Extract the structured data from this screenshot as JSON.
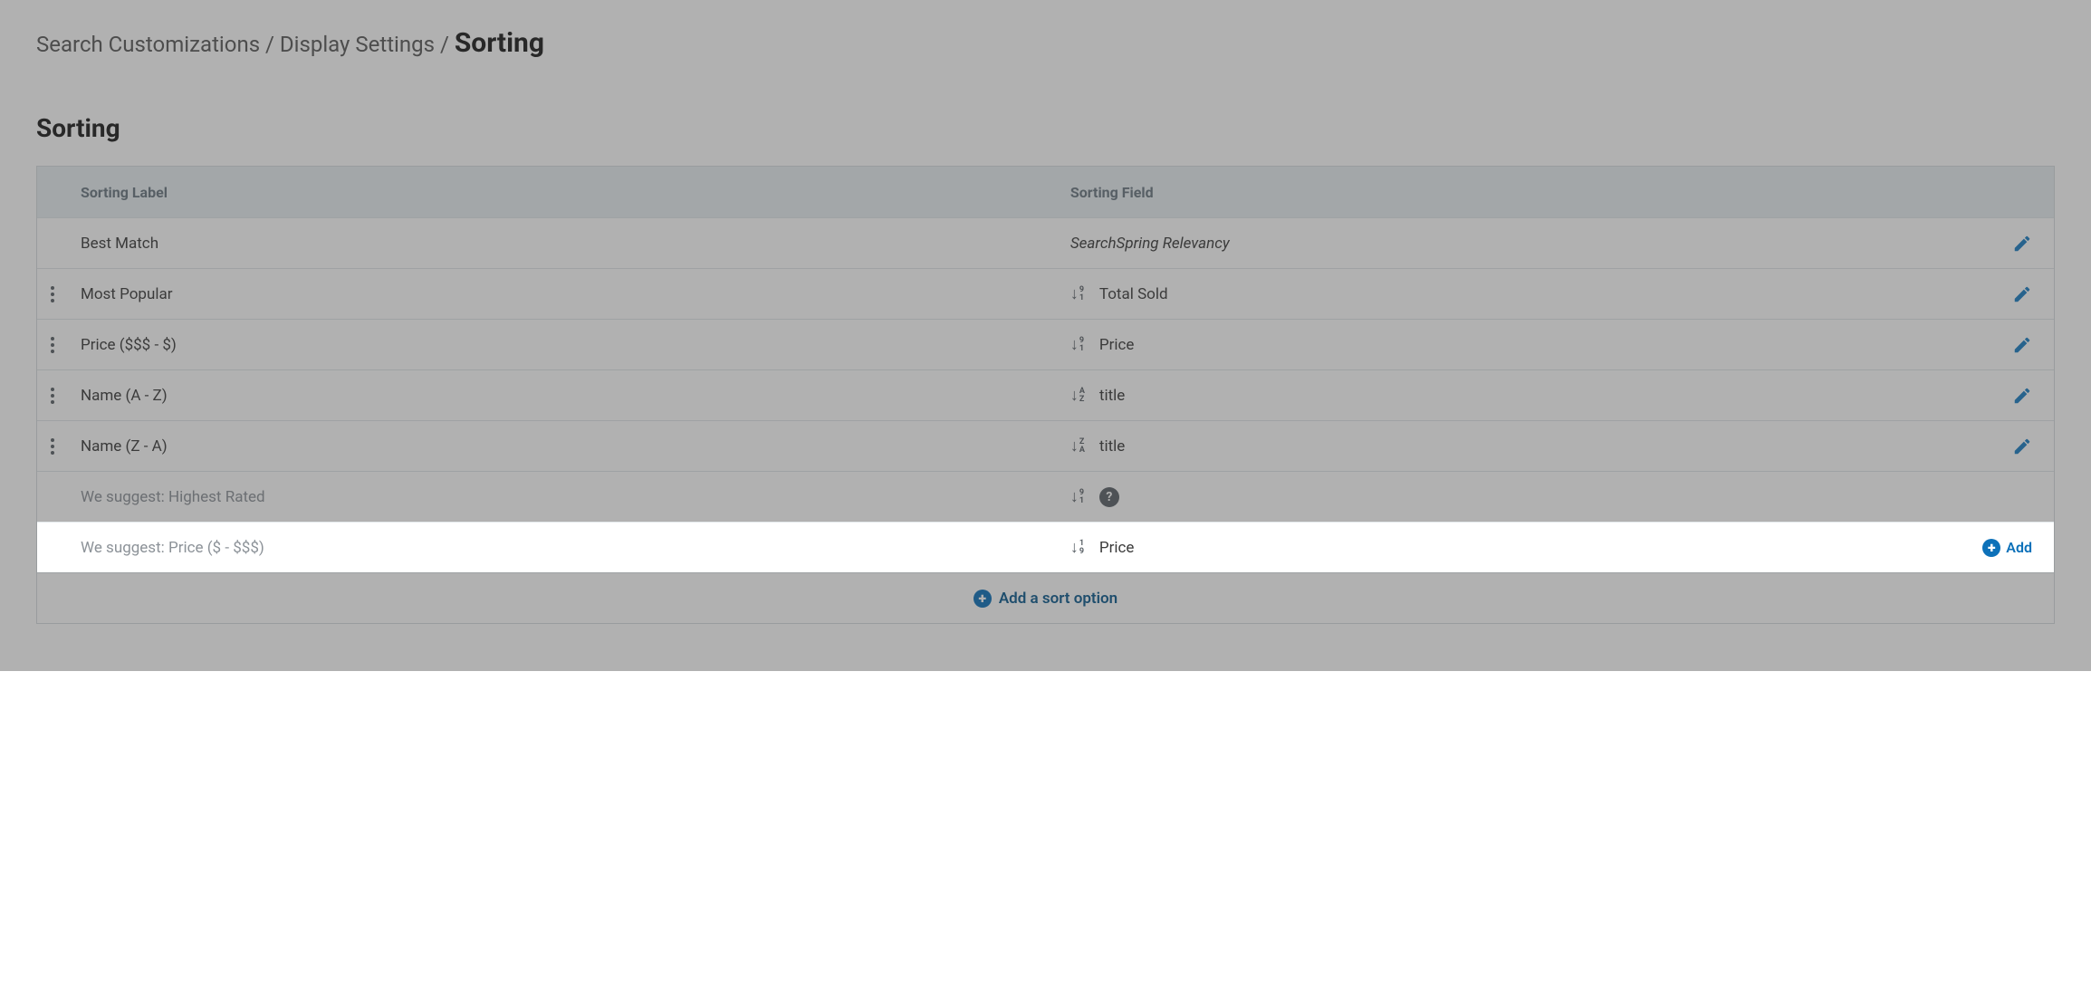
{
  "breadcrumb": {
    "part1": "Search Customizations",
    "part2": "Display Settings",
    "current": "Sorting",
    "sep": " / "
  },
  "section_title": "Sorting",
  "columns": {
    "label": "Sorting Label",
    "field": "Sorting Field"
  },
  "rows": [
    {
      "handle": false,
      "label": "Best Match",
      "sort_icon": "",
      "field": "SearchSpring Relevancy",
      "field_italic": true,
      "action": "edit"
    },
    {
      "handle": true,
      "label": "Most Popular",
      "sort_icon": "91",
      "field": "Total Sold",
      "field_italic": false,
      "action": "edit"
    },
    {
      "handle": true,
      "label": "Price ($$$ - $)",
      "sort_icon": "91",
      "field": "Price",
      "field_italic": false,
      "action": "edit"
    },
    {
      "handle": true,
      "label": "Name (A - Z)",
      "sort_icon": "AZ",
      "field": "title",
      "field_italic": false,
      "action": "edit"
    },
    {
      "handle": true,
      "label": "Name (Z - A)",
      "sort_icon": "ZA",
      "field": "title",
      "field_italic": false,
      "action": "edit"
    },
    {
      "handle": false,
      "label": "We suggest: Highest Rated",
      "label_muted": true,
      "sort_icon": "91",
      "field": "",
      "help": true,
      "action": ""
    },
    {
      "handle": false,
      "label": "We suggest: Price ($ - $$$)",
      "label_muted": true,
      "sort_icon": "19",
      "field": "Price",
      "action": "add",
      "highlight": true
    }
  ],
  "add_label": "Add",
  "footer_label": "Add a sort option",
  "colors": {
    "link": "#0d71b9",
    "link_dark": "#0d5a8e",
    "icon_gray": "#5b6268",
    "header_bg": "#e8eef2",
    "border": "#d7dde0"
  }
}
